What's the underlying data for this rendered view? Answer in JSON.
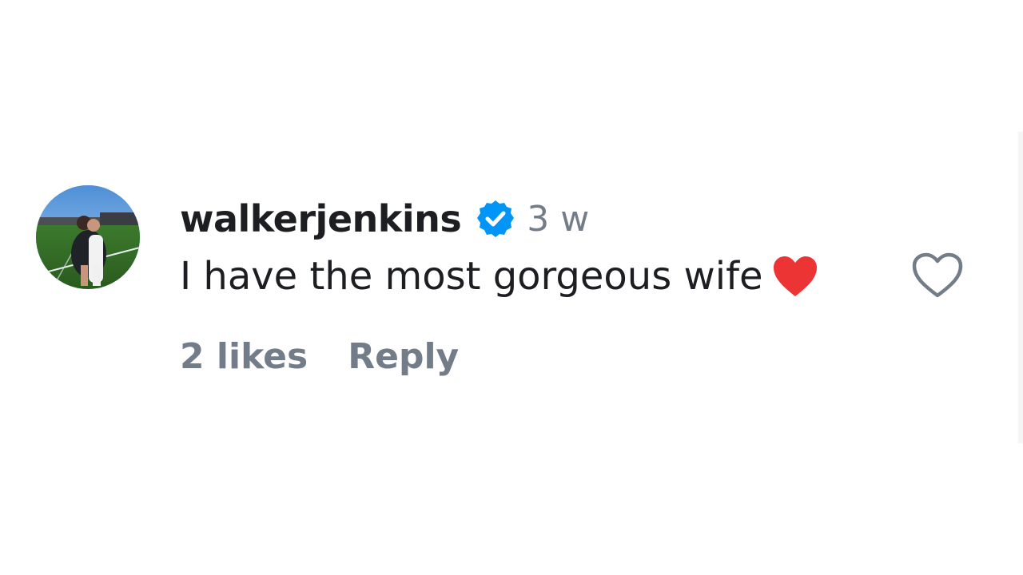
{
  "comment": {
    "username": "walkerjenkins",
    "timestamp": "3 w",
    "text": "I have the most gorgeous wife",
    "likes_label": "2 likes",
    "reply_label": "Reply",
    "avatar_icon": "profile-photo",
    "verified_icon": "verified-badge-icon",
    "inline_emoji": "red-heart-emoji",
    "like_icon": "heart-outline-icon"
  },
  "colors": {
    "verified_blue": "#0095f6",
    "heart_red": "#ed3434",
    "username_text": "#1c1e21",
    "muted_text": "#737d8a"
  }
}
